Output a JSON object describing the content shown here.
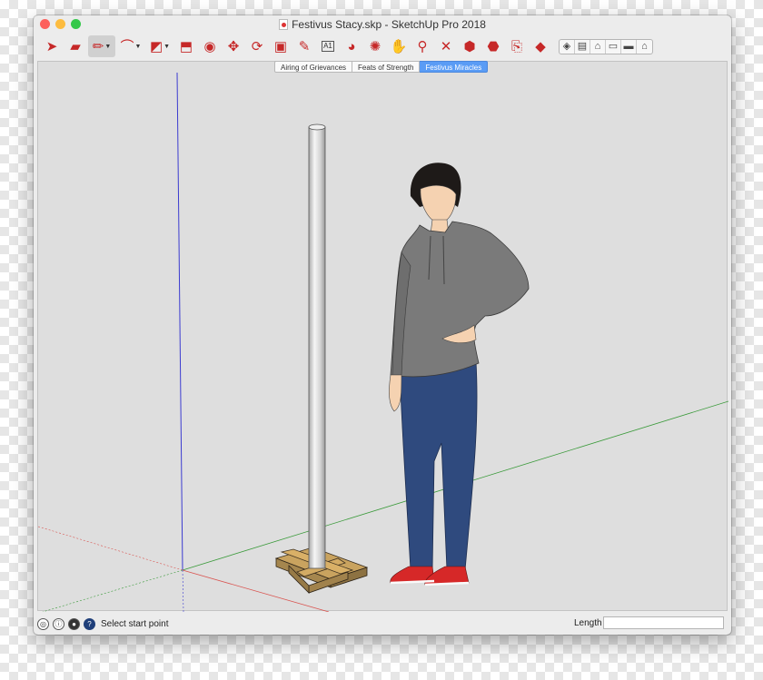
{
  "window": {
    "title": "Festivus Stacy.skp - SketchUp Pro 2018",
    "traffic_colors": [
      "#fc605c",
      "#fdbc40",
      "#34c84a"
    ]
  },
  "toolbar": {
    "tools": [
      {
        "name": "select-tool",
        "glyph": "➤"
      },
      {
        "name": "eraser-tool",
        "glyph": "▰"
      },
      {
        "name": "pencil-line-tool",
        "glyph": "✏",
        "selected": true,
        "dropdown": true
      },
      {
        "name": "arc-tool",
        "glyph": "⌒",
        "dropdown": true
      },
      {
        "name": "rectangle-tool",
        "glyph": "◩",
        "dropdown": true
      },
      {
        "name": "push-pull-tool",
        "glyph": "⬒"
      },
      {
        "name": "offset-tool",
        "glyph": "◉"
      },
      {
        "name": "move-tool",
        "glyph": "✥"
      },
      {
        "name": "rotate-tool",
        "glyph": "⟳"
      },
      {
        "name": "scale-tool",
        "glyph": "▣"
      },
      {
        "name": "tape-measure-tool",
        "glyph": "✎"
      },
      {
        "name": "text-tool",
        "glyph": "A1"
      },
      {
        "name": "paint-bucket-tool",
        "glyph": "◕"
      },
      {
        "name": "orbit-tool",
        "glyph": "✺"
      },
      {
        "name": "pan-tool",
        "glyph": "✋"
      },
      {
        "name": "zoom-tool",
        "glyph": "⚲"
      },
      {
        "name": "zoom-extents-tool",
        "glyph": "✕"
      },
      {
        "name": "warehouse-tool",
        "glyph": "⬢"
      },
      {
        "name": "extension-warehouse-tool",
        "glyph": "⬣"
      },
      {
        "name": "send-to-layout-tool",
        "glyph": "⎘"
      },
      {
        "name": "extension-manager-tool",
        "glyph": "◆"
      }
    ],
    "camera_views": [
      {
        "name": "iso-view",
        "glyph": "◈"
      },
      {
        "name": "top-view",
        "glyph": "▤"
      },
      {
        "name": "front-view",
        "glyph": "⌂"
      },
      {
        "name": "right-view",
        "glyph": "▭"
      },
      {
        "name": "back-view",
        "glyph": "▬"
      },
      {
        "name": "left-view",
        "glyph": "⌂"
      }
    ]
  },
  "scenes": {
    "tabs": [
      {
        "label": "Airing of Grievances",
        "active": false
      },
      {
        "label": "Feats of Strength",
        "active": false
      },
      {
        "label": "Festivus Miracles",
        "active": true
      }
    ]
  },
  "status": {
    "text": "Select start point",
    "measurement_label": "Length",
    "measurement_value": ""
  },
  "model": {
    "axis_colors": {
      "red": "#d9534f",
      "green": "#3a9a3a",
      "blue": "#3b3bd0"
    },
    "pole_color": "#d8d8d8",
    "base_color": "#c9a35f",
    "shirt_color": "#7a7a7a",
    "jeans_color": "#2f4a7e",
    "shoe_color": "#d62828"
  }
}
